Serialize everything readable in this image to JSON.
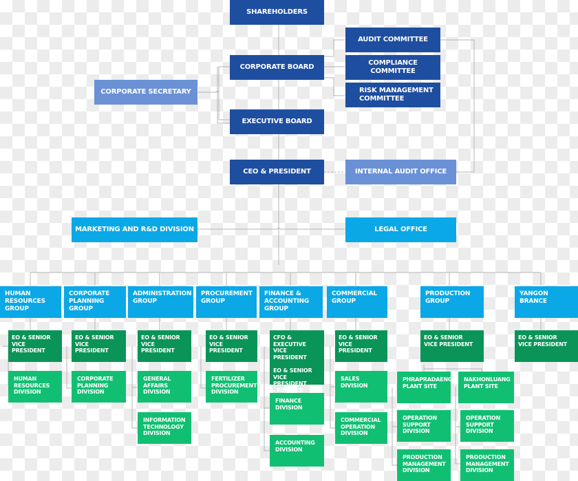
{
  "top": {
    "shareholders": "SHAREHOLDERS",
    "corporate_board": "CORPORATE BOARD",
    "executive_board": "EXECUTIVE BOARD",
    "ceo": "CEO & PRESIDENT",
    "corporate_secretary": "CORPORATE SECRETARY",
    "internal_audit": "INTERNAL AUDIT OFFICE"
  },
  "committees": [
    "AUDIT COMMITTEE",
    "COMPLIANCE COMMITTEE",
    "RISK MANAGEMENT\nCOMMITTEE"
  ],
  "staff": {
    "marketing": "MARKETING AND R&D DIVISION",
    "legal": "LEGAL OFFICE"
  },
  "groups": [
    {
      "name": "HUMAN\nRESOURCES\nGROUP",
      "exec": "EO & SENIOR\nVICE PRESIDENT",
      "divisions": [
        "HUMAN\nRESOURCES\nDIVISION"
      ]
    },
    {
      "name": "CORPORATE\nPLANNING\nGROUP",
      "exec": "EO & SENIOR\nVICE PRESIDENT",
      "divisions": [
        "CORPORATE\nPLANNING\nDIVISION"
      ]
    },
    {
      "name": "ADMINISTRATION\nGROUP",
      "exec": "EO & SENIOR\nVICE PRESIDENT",
      "divisions": [
        "GENERAL\nAFFAIRS\nDIVISION",
        "INFORMATION\nTECHNOLOGY\nDIVISION"
      ]
    },
    {
      "name": "PROCUREMENT\nGROUP",
      "exec": "EO & SENIOR\nVICE PRESIDENT",
      "divisions": [
        "FERTILIZER\nPROCUREMENT\nDIVISION"
      ]
    },
    {
      "name": "FINANCE &\nACCOUNTING\nGROUP",
      "exec": "CFO & EXECUTIVE\nVICE PRESIDENT\n\nEO & SENIOR VICE\nPRESIDENT\n - FINANCE",
      "divisions": [
        "FINANCE\nDIVISION",
        "ACCOUNTING\nDIVISION"
      ]
    },
    {
      "name": "COMMERCIAL\nGROUP",
      "exec": "EO & SENIOR\nVICE PRESIDENT",
      "divisions": [
        "SALES DIVISION",
        "COMMERCIAL\nOPERATION\nDIVISION"
      ]
    },
    {
      "name": "PRODUCTION\nGROUP",
      "exec": "EO & SENIOR\nVICE PRESIDENT",
      "plants": [
        {
          "name": "PHRAPRADAENG\nPLANT SITE",
          "divisions": [
            "OPERATION\nSUPPORT\nDIVISION",
            "PRODUCTION\nMANAGEMENT\nDIVISION"
          ]
        },
        {
          "name": "NAKHONLUANG\nPLANT SITE",
          "divisions": [
            "OPERATION\nSUPPORT\nDIVISION",
            "PRODUCTION\nMANAGEMENT\nDIVISION"
          ]
        }
      ]
    },
    {
      "name": "YANGON\nBRANCE",
      "exec": "EO & SENIOR\nVICE PRESIDENT",
      "divisions": []
    }
  ],
  "colors": {
    "board": "#1e4ea0",
    "support_office": "#6a91d6",
    "group": "#0aa8e6",
    "executive": "#0a9457",
    "division": "#11bf73",
    "connector": "#b4b4b4"
  }
}
